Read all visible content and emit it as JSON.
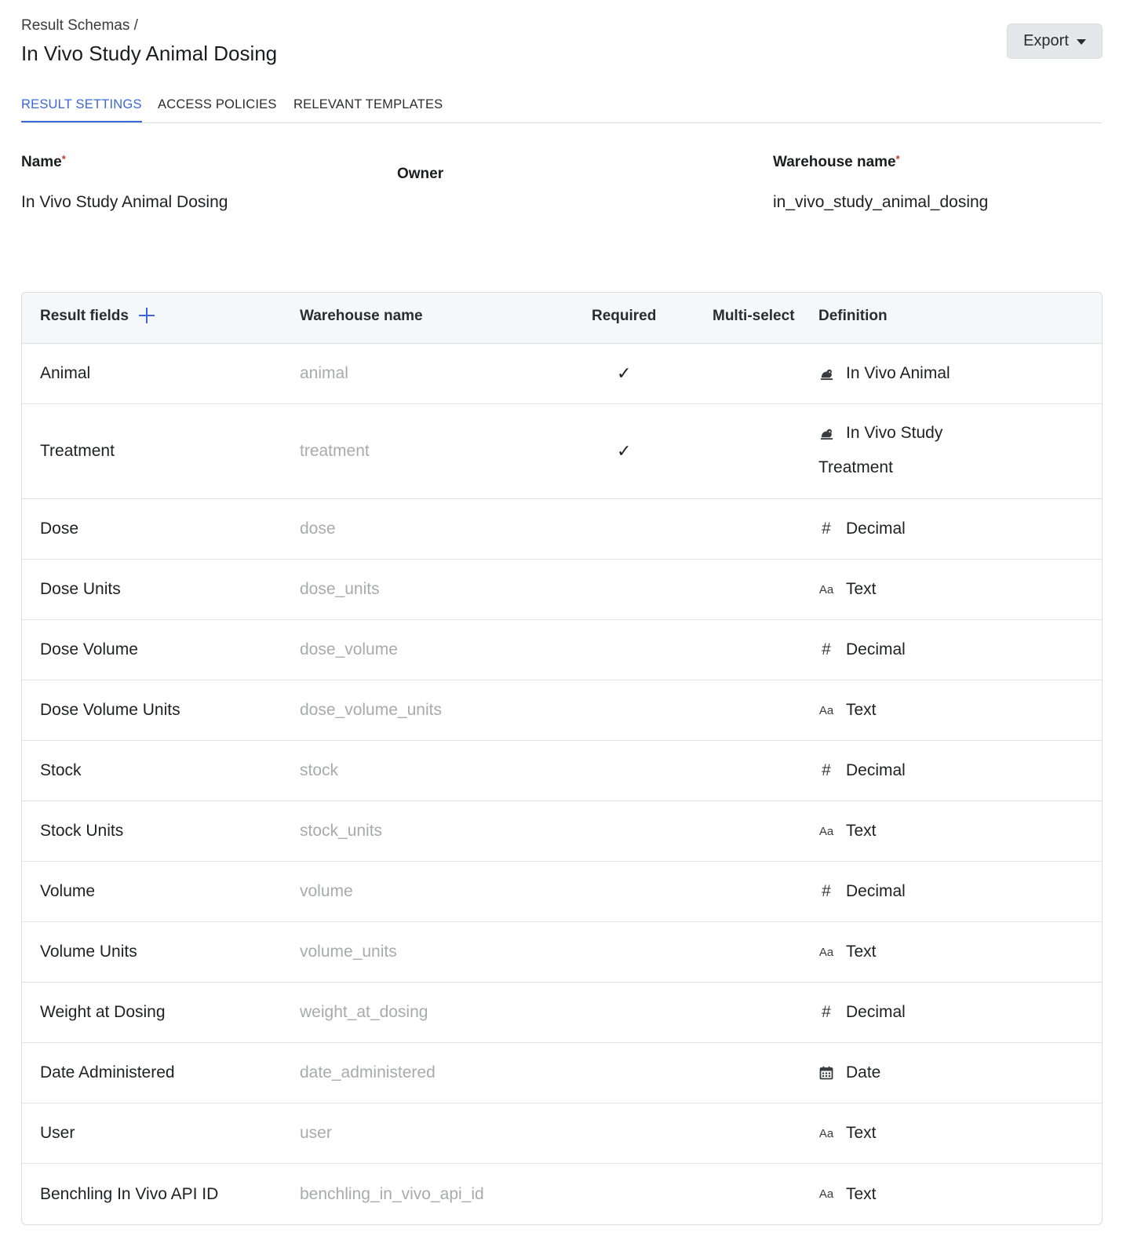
{
  "breadcrumb": "Result Schemas /",
  "title": "In Vivo Study Animal Dosing",
  "export_label": "Export",
  "tabs": [
    "RESULT SETTINGS",
    "ACCESS POLICIES",
    "RELEVANT TEMPLATES"
  ],
  "settings": {
    "name_label": "Name",
    "name_value": "In Vivo Study Animal Dosing",
    "owner_label": "Owner",
    "warehouse_label": "Warehouse name",
    "warehouse_value": "in_vivo_study_animal_dosing",
    "required_marker": "*"
  },
  "table": {
    "headers": [
      "Result fields",
      "Warehouse name",
      "Required",
      "Multi-select",
      "Definition"
    ],
    "check": "✓",
    "rows": [
      {
        "name": "Animal",
        "warehouse": "animal",
        "required": true,
        "def_icon": "animal-icon",
        "definition": "In Vivo Animal"
      },
      {
        "name": "Treatment",
        "warehouse": "treatment",
        "required": true,
        "def_icon": "animal-icon",
        "definition_line1": "In Vivo Study",
        "definition_line2": "Treatment"
      },
      {
        "name": "Dose",
        "warehouse": "dose",
        "required": false,
        "def_icon": "hash-icon",
        "definition": "Decimal"
      },
      {
        "name": "Dose Units",
        "warehouse": "dose_units",
        "required": false,
        "def_icon": "text-icon",
        "definition": "Text"
      },
      {
        "name": "Dose Volume",
        "warehouse": "dose_volume",
        "required": false,
        "def_icon": "hash-icon",
        "definition": "Decimal"
      },
      {
        "name": "Dose Volume Units",
        "warehouse": "dose_volume_units",
        "required": false,
        "def_icon": "text-icon",
        "definition": "Text"
      },
      {
        "name": "Stock",
        "warehouse": "stock",
        "required": false,
        "def_icon": "hash-icon",
        "definition": "Decimal"
      },
      {
        "name": "Stock Units",
        "warehouse": "stock_units",
        "required": false,
        "def_icon": "text-icon",
        "definition": "Text"
      },
      {
        "name": "Volume",
        "warehouse": "volume",
        "required": false,
        "def_icon": "hash-icon",
        "definition": "Decimal"
      },
      {
        "name": "Volume Units",
        "warehouse": "volume_units",
        "required": false,
        "def_icon": "text-icon",
        "definition": "Text"
      },
      {
        "name": "Weight at Dosing",
        "warehouse": "weight_at_dosing",
        "required": false,
        "def_icon": "hash-icon",
        "definition": "Decimal"
      },
      {
        "name": "Date Administered",
        "warehouse": "date_administered",
        "required": false,
        "def_icon": "calendar-icon",
        "definition": "Date"
      },
      {
        "name": "User",
        "warehouse": "user",
        "required": false,
        "def_icon": "text-icon",
        "definition": "Text"
      },
      {
        "name": "Benchling In Vivo API ID",
        "warehouse": "benchling_in_vivo_api_id",
        "required": false,
        "def_icon": "text-icon",
        "definition": "Text"
      }
    ]
  },
  "icons": {
    "text_glyph": "Aa",
    "hash_glyph": "#"
  },
  "colors": {
    "accent": "#3a67d8",
    "required_marker": "#c0392b",
    "muted_text": "#a9aaae"
  }
}
